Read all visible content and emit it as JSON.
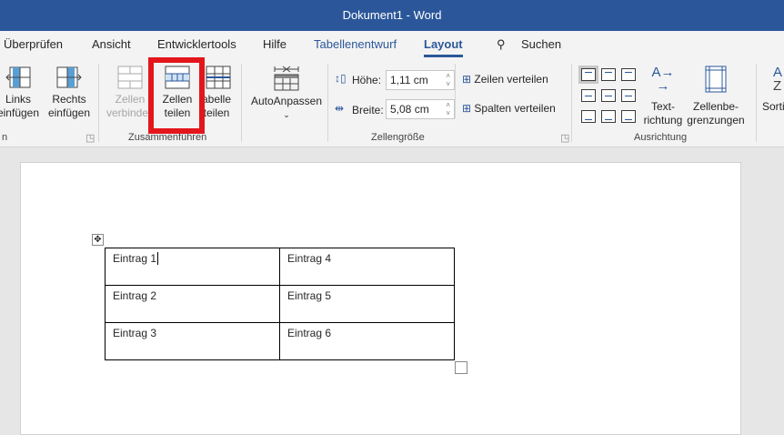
{
  "title": "Dokument1  -  Word",
  "tabs": [
    "Überprüfen",
    "Ansicht",
    "Entwicklertools",
    "Hilfe",
    "Tabellenentwurf",
    "Layout"
  ],
  "search": "Suchen",
  "ribbon": {
    "links": [
      "Links",
      "einfügen"
    ],
    "rechts": [
      "Rechts",
      "einfügen"
    ],
    "zellen_verbinden": [
      "Zellen",
      "verbinden"
    ],
    "zellen_teilen": [
      "Zellen",
      "teilen"
    ],
    "tabelle_teilen": [
      "Tabelle",
      "teilen"
    ],
    "group_rows_cols": "n",
    "group_merge": "Zusammenführen",
    "autoanpassen": "AutoAnpassen",
    "hoehe_label": "Höhe:",
    "hoehe_value": "1,11 cm",
    "breite_label": "Breite:",
    "breite_value": "5,08 cm",
    "zeilen_verteilen": "Zeilen verteilen",
    "spalten_verteilen": "Spalten verteilen",
    "group_size": "Zellengröße",
    "textrichtung": [
      "Text-",
      "richtung"
    ],
    "zellenbegrenzungen": [
      "Zellenbe-",
      "grenzungen"
    ],
    "group_align": "Ausrichtung",
    "sortieren": "Sorti"
  },
  "table": [
    [
      "Eintrag 1",
      "Eintrag 4"
    ],
    [
      "Eintrag 2",
      "Eintrag 5"
    ],
    [
      "Eintrag 3",
      "Eintrag 6"
    ]
  ],
  "colors": {
    "accent": "#2b579a",
    "highlight": "#e3161b"
  }
}
